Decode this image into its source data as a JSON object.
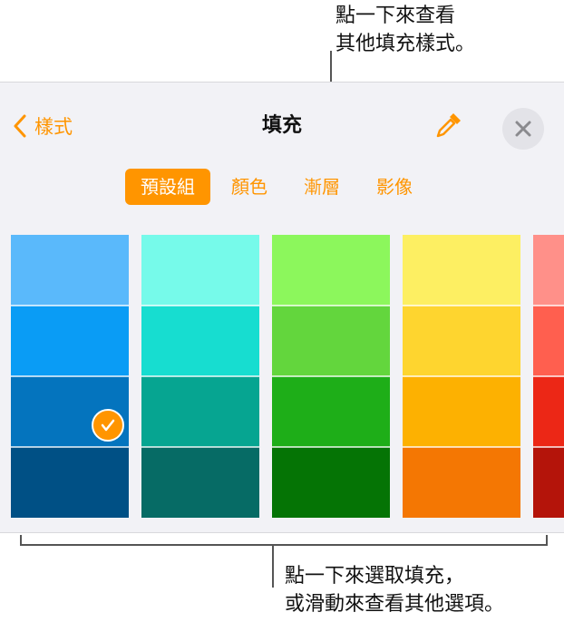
{
  "callouts": {
    "top_line1": "點一下來查看",
    "top_line2": "其他填充樣式。",
    "bottom_line1": "點一下來選取填充，",
    "bottom_line2": "或滑動來查看其他選項。"
  },
  "header": {
    "back_label": "樣式",
    "title": "填充",
    "back_icon": "chevron-left-icon",
    "dropper_icon": "eyedropper-icon",
    "close_icon": "close-icon"
  },
  "tabs": [
    {
      "label": "預設組",
      "active": true
    },
    {
      "label": "顏色",
      "active": false
    },
    {
      "label": "漸層",
      "active": false
    },
    {
      "label": "影像",
      "active": false
    }
  ],
  "accent_color": "#ff9500",
  "swatches": [
    {
      "name": "blue",
      "shades": [
        "#5ab9fb",
        "#0a9cf5",
        "#0474be",
        "#005085"
      ],
      "selected_shade": 2
    },
    {
      "name": "teal",
      "shades": [
        "#76faea",
        "#17ddd0",
        "#06a591",
        "#066b65"
      ],
      "selected_shade": null
    },
    {
      "name": "green",
      "shades": [
        "#8cf75c",
        "#63d63d",
        "#1eae18",
        "#057405"
      ],
      "selected_shade": null
    },
    {
      "name": "yellow",
      "shades": [
        "#fdef62",
        "#fed52f",
        "#fdb101",
        "#f47703"
      ],
      "selected_shade": null
    },
    {
      "name": "red",
      "shades": [
        "#ff9089",
        "#ff5f4f",
        "#ec2716",
        "#b4140a"
      ],
      "selected_shade": null
    }
  ]
}
